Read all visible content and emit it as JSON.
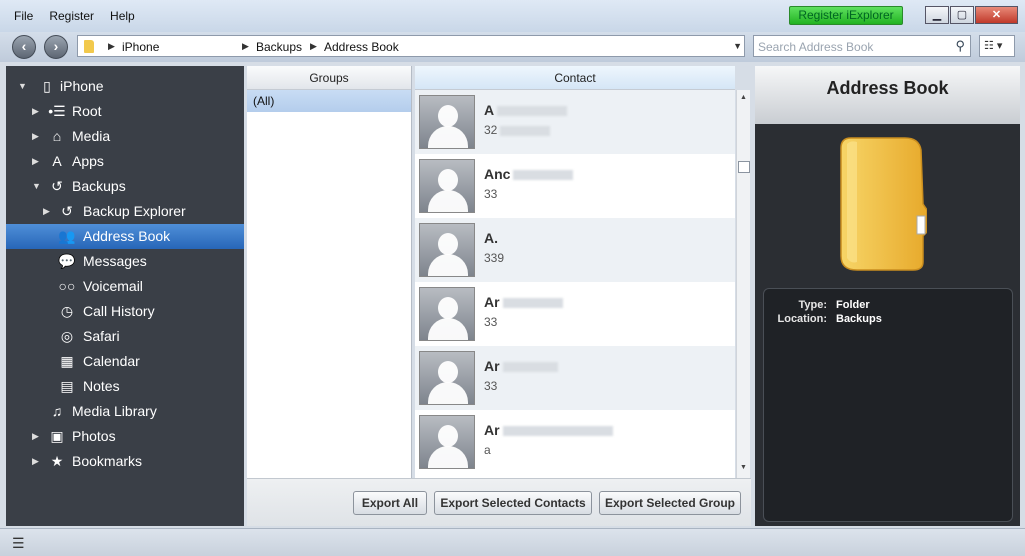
{
  "menu": [
    "File",
    "Register",
    "Help"
  ],
  "register_button": "Register iExplorer",
  "window_controls": {
    "minimize": "▁",
    "maximize": "▢",
    "close": "✕"
  },
  "nav": {
    "back_icon": "back-arrow-icon",
    "forward_icon": "forward-arrow-icon",
    "breadcrumb": [
      "iPhone",
      "Backups",
      "Address Book"
    ],
    "search_placeholder": "Search Address Book",
    "view_icon": "view-list-icon"
  },
  "sidebar": {
    "items": [
      {
        "label": "iPhone",
        "icon": "phone-icon",
        "glyph": "▯",
        "arrow": "▼",
        "level": 0
      },
      {
        "label": "Root",
        "icon": "root-icon",
        "glyph": "•☰",
        "arrow": "▶",
        "level": 1
      },
      {
        "label": "Media",
        "icon": "media-icon",
        "glyph": "⌂",
        "arrow": "▶",
        "level": 1
      },
      {
        "label": "Apps",
        "icon": "apps-icon",
        "glyph": "A",
        "arrow": "▶",
        "level": 1
      },
      {
        "label": "Backups",
        "icon": "backups-icon",
        "glyph": "↺",
        "arrow": "▼",
        "level": 1
      },
      {
        "label": "Backup Explorer",
        "icon": "backup-explorer-icon",
        "glyph": "↺",
        "arrow": "▶",
        "level": 2
      },
      {
        "label": "Address Book",
        "icon": "address-book-icon",
        "glyph": "👥",
        "arrow": "",
        "level": 2,
        "selected": true
      },
      {
        "label": "Messages",
        "icon": "messages-icon",
        "glyph": "💬",
        "arrow": "",
        "level": 2
      },
      {
        "label": "Voicemail",
        "icon": "voicemail-icon",
        "glyph": "○○",
        "arrow": "",
        "level": 2
      },
      {
        "label": "Call History",
        "icon": "call-history-icon",
        "glyph": "◷",
        "arrow": "",
        "level": 2
      },
      {
        "label": "Safari",
        "icon": "safari-icon",
        "glyph": "◎",
        "arrow": "",
        "level": 2
      },
      {
        "label": "Calendar",
        "icon": "calendar-icon",
        "glyph": "▦",
        "arrow": "",
        "level": 2
      },
      {
        "label": "Notes",
        "icon": "notes-icon",
        "glyph": "▤",
        "arrow": "",
        "level": 2
      },
      {
        "label": "Media Library",
        "icon": "music-icon",
        "glyph": "♫",
        "arrow": "",
        "level": 1
      },
      {
        "label": "Photos",
        "icon": "photos-icon",
        "glyph": "▣",
        "arrow": "▶",
        "level": 1
      },
      {
        "label": "Bookmarks",
        "icon": "star-icon",
        "glyph": "★",
        "arrow": "▶",
        "level": 1
      }
    ]
  },
  "groups": {
    "header": "Groups",
    "items": [
      "(All)"
    ]
  },
  "contacts": {
    "header": "Contact",
    "rows": [
      {
        "name": "A",
        "sub": "32",
        "blur_name": 70,
        "blur_sub": 50
      },
      {
        "name": "Anc",
        "sub": "33",
        "blur_name": 60,
        "blur_sub": 0
      },
      {
        "name": "A.",
        "sub": "339",
        "blur_name": 0,
        "blur_sub": 0
      },
      {
        "name": "Ar",
        "sub": "33",
        "blur_name": 60,
        "blur_sub": 0
      },
      {
        "name": "Ar",
        "sub": "33",
        "blur_name": 55,
        "blur_sub": 0
      },
      {
        "name": "Ar",
        "sub": "a",
        "blur_name": 110,
        "blur_sub": 0
      }
    ]
  },
  "export": {
    "all": "Export All",
    "selected_contacts": "Export Selected Contacts",
    "selected_group": "Export Selected Group"
  },
  "info": {
    "title": "Address Book",
    "details": [
      {
        "key": "Type:",
        "value": "Folder"
      },
      {
        "key": "Location:",
        "value": "Backups"
      }
    ]
  },
  "colors": {
    "selected": "#2f6fc0",
    "sidebar": "#3a3f47",
    "register": "#2ebd2e",
    "folder": "#f2c94c"
  }
}
